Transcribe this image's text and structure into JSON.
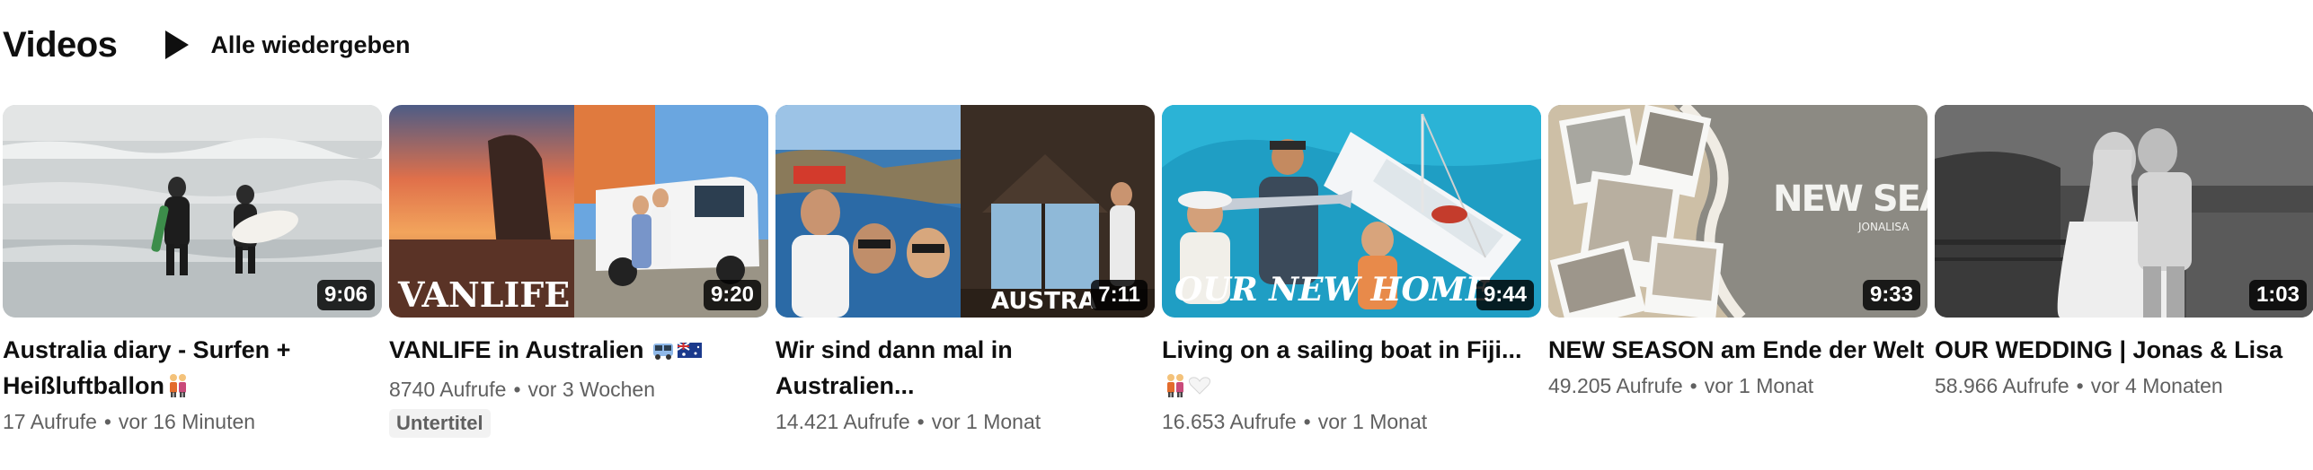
{
  "shelf": {
    "title": "Videos",
    "play_all_label": "Alle wiedergeben"
  },
  "videos": [
    {
      "title": "Australia diary - Surfen + Heißluftballon",
      "duration": "9:06",
      "views": "17 Aufrufe",
      "age": "vor 16 Minuten",
      "badge": "",
      "thumbnail_icon": "surfers-beach-thumbnail",
      "title_emoji": "couple-emoji"
    },
    {
      "title": "VANLIFE in Australien",
      "duration": "9:20",
      "views": "8740 Aufrufe",
      "age": "vor 3 Wochen",
      "badge": "Untertitel",
      "thumbnail_icon": "campervan-sunset-thumbnail",
      "thumbnail_text": "VANLIFE",
      "title_emoji": "van-australia-flag-emoji"
    },
    {
      "title": "Wir sind dann mal in Australien...",
      "duration": "7:11",
      "views": "14.421 Aufrufe",
      "age": "vor 1 Monat",
      "badge": "",
      "thumbnail_icon": "coast-cabin-thumbnail",
      "thumbnail_text": "AUSTRA",
      "title_emoji": ""
    },
    {
      "title": "Living on a sailing boat in Fiji...",
      "duration": "9:44",
      "views": "16.653 Aufrufe",
      "age": "vor 1 Monat",
      "badge": "",
      "thumbnail_icon": "sailing-boat-thumbnail",
      "thumbnail_text": "OUR NEW HOME",
      "title_emoji": "couple-white-heart-emoji"
    },
    {
      "title": "NEW SEASON am Ende der Welt",
      "duration": "9:33",
      "views": "49.205 Aufrufe",
      "age": "vor 1 Monat",
      "badge": "",
      "thumbnail_icon": "polaroid-collage-thumbnail",
      "thumbnail_text": "NEW SEASON",
      "thumbnail_subtext": "JONALISA",
      "title_emoji": ""
    },
    {
      "title": "OUR WEDDING | Jonas & Lisa",
      "duration": "1:03",
      "views": "58.966 Aufrufe",
      "age": "vor 4 Monaten",
      "badge": "",
      "thumbnail_icon": "wedding-couple-thumbnail",
      "title_emoji": ""
    }
  ],
  "colors": {
    "text_primary": "#0f0f0f",
    "text_secondary": "#606060",
    "badge_bg": "#f2f2f2",
    "duration_bg": "#000000"
  }
}
